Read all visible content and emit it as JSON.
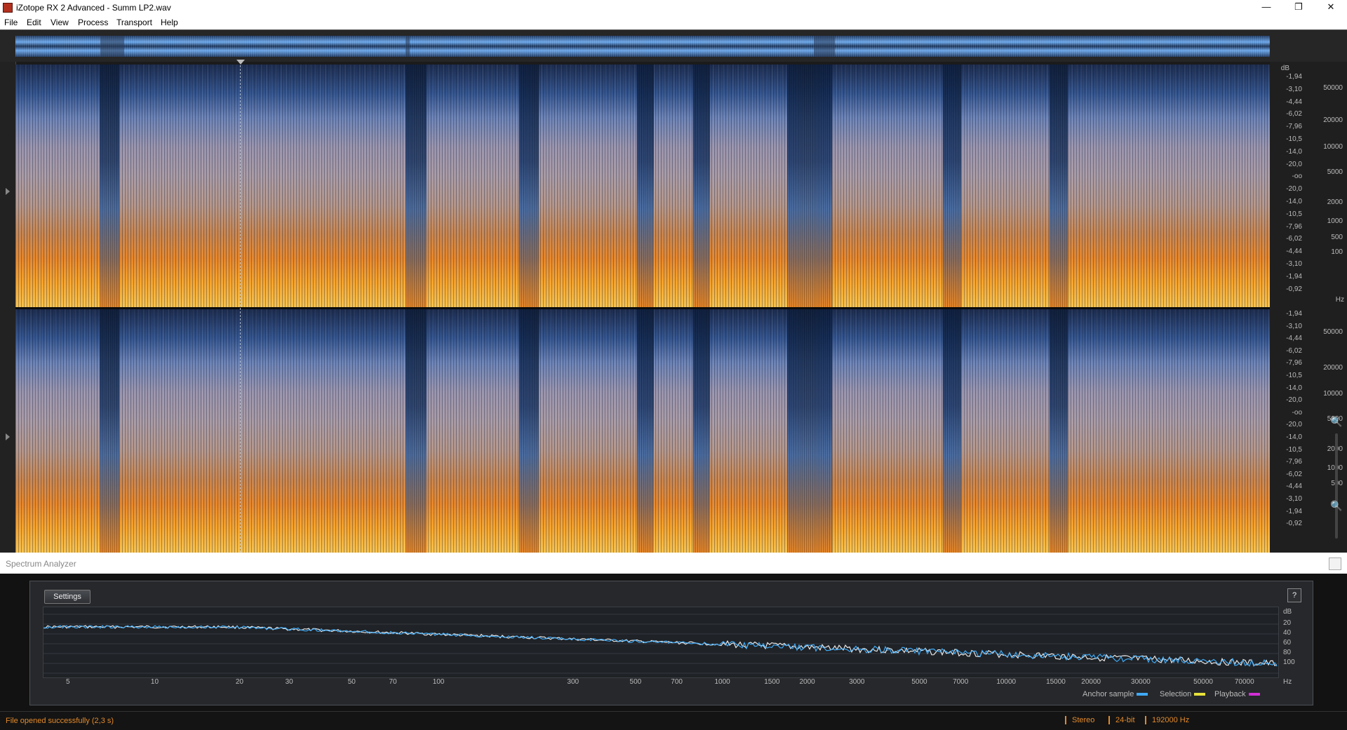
{
  "window": {
    "title": "iZotope RX 2 Advanced - Summ LP2.wav",
    "minimize_glyph": "—",
    "restore_glyph": "❐",
    "close_glyph": "✕"
  },
  "menu": {
    "file": "File",
    "edit": "Edit",
    "view": "View",
    "process": "Process",
    "transport": "Transport",
    "help": "Help"
  },
  "db_scale": {
    "unit": "dB",
    "top_labels": [
      "-1,94",
      "-3,10",
      "-4,44",
      "-6,02",
      "-7,96",
      "-10,5",
      "-14,0",
      "-20,0",
      "-oo",
      "-20,0",
      "-14,0",
      "-10,5",
      "-7,96",
      "-6,02",
      "-4,44",
      "-3,10",
      "-1,94",
      "-0,92"
    ],
    "bottom_labels": [
      "-1,94",
      "-3,10",
      "-4,44",
      "-6,02",
      "-7,96",
      "-10,5",
      "-14,0",
      "-20,0",
      "-oo",
      "-20,0",
      "-14,0",
      "-10,5",
      "-7,96",
      "-6,02",
      "-4,44",
      "-3,10",
      "-1,94",
      "-0,92"
    ]
  },
  "hz_scale": {
    "unit": "Hz",
    "top_labels": [
      "50000",
      "20000",
      "10000",
      "5000",
      "2000",
      "1000",
      "500",
      "100"
    ],
    "bottom_labels": [
      "50000",
      "20000",
      "10000",
      "5000",
      "2000",
      "1000",
      "500"
    ]
  },
  "zoom": {
    "zoom_in_glyph": "🔍",
    "zoom_out_glyph": "🔍"
  },
  "spectrum_analyzer": {
    "title": "Spectrum Analyzer",
    "settings_label": "Settings",
    "help_label": "?",
    "db_unit": "dB",
    "db_labels": [
      "20",
      "40",
      "60",
      "80",
      "100"
    ],
    "hz_unit": "Hz",
    "hz_labels": [
      "5",
      "10",
      "20",
      "30",
      "50",
      "70",
      "100",
      "300",
      "500",
      "700",
      "1000",
      "1500",
      "2000",
      "3000",
      "5000",
      "7000",
      "10000",
      "15000",
      "20000",
      "30000",
      "50000",
      "70000"
    ],
    "legend": {
      "anchor": "Anchor sample",
      "selection": "Selection",
      "playback": "Playback",
      "anchor_color": "#3fa9f5",
      "selection_color": "#e6e23a",
      "playback_color": "#d22fd6"
    }
  },
  "status": {
    "message": "File opened successfully (2,3 s)",
    "channels": "Stereo",
    "bit_depth": "24-bit",
    "sample_rate": "192000 Hz"
  },
  "colors": {
    "status_accent": "#e38a2b",
    "spectro_hot": "#f6a42c",
    "spectro_cold": "#1c2b4d"
  }
}
